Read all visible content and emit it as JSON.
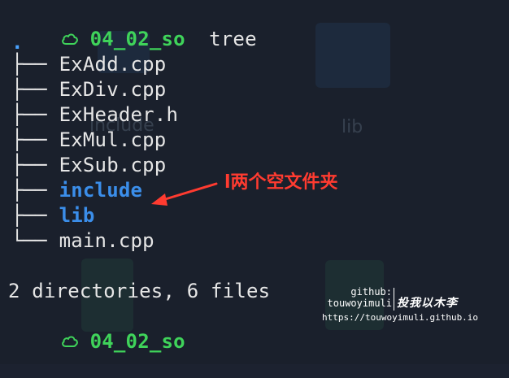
{
  "prompt": {
    "directory": "04_02_so",
    "command": "tree"
  },
  "tree": {
    "root": ".",
    "entries": [
      {
        "branch": "├──",
        "name": "ExAdd.cpp",
        "type": "file"
      },
      {
        "branch": "├──",
        "name": "ExDiv.cpp",
        "type": "file"
      },
      {
        "branch": "├──",
        "name": "ExHeader.h",
        "type": "file"
      },
      {
        "branch": "├──",
        "name": "ExMul.cpp",
        "type": "file"
      },
      {
        "branch": "├──",
        "name": "ExSub.cpp",
        "type": "file"
      },
      {
        "branch": "├──",
        "name": "include",
        "type": "directory"
      },
      {
        "branch": "├──",
        "name": "lib",
        "type": "directory"
      },
      {
        "branch": "└──",
        "name": "main.cpp",
        "type": "file"
      }
    ],
    "summary": "2 directories, 6 files"
  },
  "prompt2": {
    "directory": "04_02_so"
  },
  "annotation": {
    "text": "l两个空文件夹",
    "color": "#ff3b30"
  },
  "background_ghosts": {
    "folder_label_1": "include",
    "folder_label_2": "lib"
  },
  "watermark": {
    "line1": "github:",
    "line2": "touwoyimuli",
    "signature": "投我以木李",
    "url": "https://touwoyimuli.github.io"
  },
  "colors": {
    "background": "#1a202c",
    "prompt_dir": "#3fd35a",
    "directory_entry": "#3b8eea",
    "text": "#e6e6e6",
    "annotation": "#ff3b30"
  }
}
